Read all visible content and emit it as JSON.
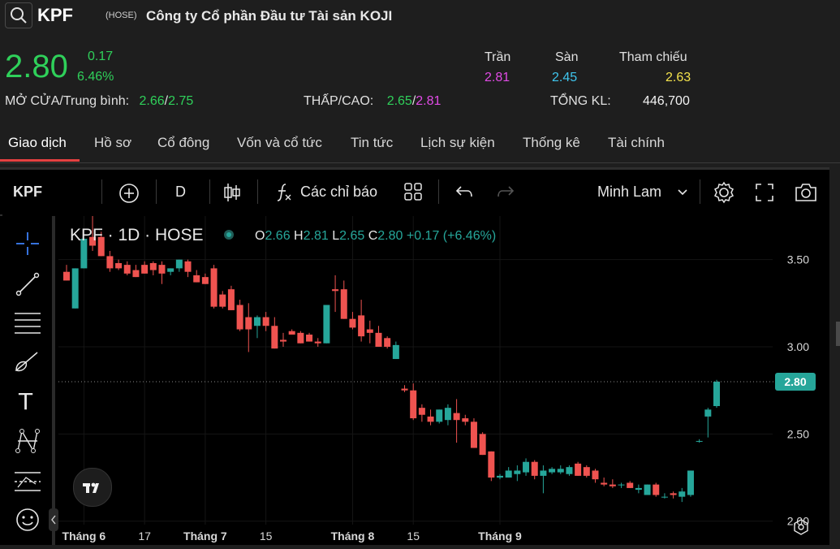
{
  "header": {
    "ticker": "KPF",
    "exchange": "(HOSE)",
    "company": "Công ty Cổ phần Đầu tư Tài sản KOJI",
    "price": "2.80",
    "change": "0.17",
    "change_pct": "6.46%",
    "open_avg_label": "MỞ CỬA/Trung bình:",
    "open": "2.66",
    "avg": "2.75",
    "lowhigh_label": "THẤP/CAO:",
    "low": "2.65",
    "high": "2.81",
    "ceiling_label": "Trần",
    "ceiling": "2.81",
    "floor_label": "Sàn",
    "floor": "2.45",
    "ref_label": "Tham chiếu",
    "ref": "2.63",
    "volume_label": "TỔNG KL:",
    "volume": "446,700",
    "slash": "/"
  },
  "tabs": [
    "Giao dịch",
    "Hồ sơ",
    "Cổ đông",
    "Vốn và cổ tức",
    "Tin tức",
    "Lịch sự kiện",
    "Thống kê",
    "Tài chính"
  ],
  "toolbar": {
    "symbol": "KPF",
    "interval": "D",
    "indicators": "Các chỉ báo",
    "theme": "Minh Lam"
  },
  "legend": {
    "title": "KPF · 1D · HOSE",
    "o_label": "O",
    "o": "2.66",
    "h_label": "H",
    "h": "2.81",
    "l_label": "L",
    "l": "2.65",
    "c_label": "C",
    "c": "2.80",
    "change": "+0.17 (+6.46%)"
  },
  "colors": {
    "up": "#26a69a",
    "down": "#ef5350",
    "accent": "#e44141"
  },
  "chart_data": {
    "type": "candlestick",
    "y_ticks": [
      "3.50",
      "3.00",
      "2.50",
      "2.00"
    ],
    "ylim": [
      1.98,
      3.75
    ],
    "x_labels": [
      {
        "label": "Tháng 6",
        "index": 2
      },
      {
        "label": "17",
        "index": 9
      },
      {
        "label": "Tháng 7",
        "index": 16
      },
      {
        "label": "15",
        "index": 23
      },
      {
        "label": "Tháng 8",
        "index": 33
      },
      {
        "label": "15",
        "index": 40
      },
      {
        "label": "Tháng 9",
        "index": 50
      }
    ],
    "last_price_label": "2.80",
    "last_price": 2.8,
    "candles": [
      {
        "o": 3.43,
        "h": 3.47,
        "l": 3.38,
        "c": 3.38
      },
      {
        "o": 3.22,
        "h": 3.45,
        "l": 3.22,
        "c": 3.45
      },
      {
        "o": 3.45,
        "h": 3.62,
        "l": 3.45,
        "c": 3.62
      },
      {
        "o": 3.63,
        "h": 3.75,
        "l": 3.55,
        "c": 3.58
      },
      {
        "o": 3.63,
        "h": 3.66,
        "l": 3.52,
        "c": 3.52
      },
      {
        "o": 3.52,
        "h": 3.55,
        "l": 3.43,
        "c": 3.45
      },
      {
        "o": 3.48,
        "h": 3.5,
        "l": 3.44,
        "c": 3.45
      },
      {
        "o": 3.47,
        "h": 3.49,
        "l": 3.41,
        "c": 3.42
      },
      {
        "o": 3.44,
        "h": 3.47,
        "l": 3.4,
        "c": 3.4
      },
      {
        "o": 3.47,
        "h": 3.49,
        "l": 3.42,
        "c": 3.42
      },
      {
        "o": 3.48,
        "h": 3.49,
        "l": 3.41,
        "c": 3.44
      },
      {
        "o": 3.47,
        "h": 3.49,
        "l": 3.36,
        "c": 3.42
      },
      {
        "o": 3.43,
        "h": 3.45,
        "l": 3.41,
        "c": 3.45
      },
      {
        "o": 3.45,
        "h": 3.5,
        "l": 3.43,
        "c": 3.5
      },
      {
        "o": 3.49,
        "h": 3.5,
        "l": 3.4,
        "c": 3.43
      },
      {
        "o": 3.41,
        "h": 3.44,
        "l": 3.37,
        "c": 3.37
      },
      {
        "o": 3.4,
        "h": 3.42,
        "l": 3.36,
        "c": 3.36
      },
      {
        "o": 3.45,
        "h": 3.47,
        "l": 3.22,
        "c": 3.23
      },
      {
        "o": 3.3,
        "h": 3.32,
        "l": 3.22,
        "c": 3.23
      },
      {
        "o": 3.33,
        "h": 3.35,
        "l": 3.21,
        "c": 3.21
      },
      {
        "o": 3.24,
        "h": 3.27,
        "l": 3.09,
        "c": 3.1
      },
      {
        "o": 3.17,
        "h": 3.25,
        "l": 2.97,
        "c": 3.1
      },
      {
        "o": 3.12,
        "h": 3.18,
        "l": 3.05,
        "c": 3.17
      },
      {
        "o": 3.17,
        "h": 3.2,
        "l": 3.09,
        "c": 3.12
      },
      {
        "o": 3.12,
        "h": 3.17,
        "l": 2.99,
        "c": 2.99
      },
      {
        "o": 3.04,
        "h": 3.08,
        "l": 3.0,
        "c": 3.03
      },
      {
        "o": 3.09,
        "h": 3.1,
        "l": 3.07,
        "c": 3.07
      },
      {
        "o": 3.08,
        "h": 3.09,
        "l": 3.02,
        "c": 3.02
      },
      {
        "o": 3.07,
        "h": 3.08,
        "l": 3.03,
        "c": 3.03
      },
      {
        "o": 3.03,
        "h": 3.05,
        "l": 3.0,
        "c": 3.02
      },
      {
        "o": 3.02,
        "h": 3.24,
        "l": 3.02,
        "c": 3.24
      },
      {
        "o": 3.33,
        "h": 3.41,
        "l": 3.2,
        "c": 3.32
      },
      {
        "o": 3.33,
        "h": 3.38,
        "l": 3.16,
        "c": 3.16
      },
      {
        "o": 3.16,
        "h": 3.2,
        "l": 3.1,
        "c": 3.11
      },
      {
        "o": 3.18,
        "h": 3.27,
        "l": 3.03,
        "c": 3.06
      },
      {
        "o": 3.1,
        "h": 3.15,
        "l": 3.02,
        "c": 3.08
      },
      {
        "o": 3.08,
        "h": 3.12,
        "l": 3.0,
        "c": 3.0
      },
      {
        "o": 3.05,
        "h": 3.06,
        "l": 2.99,
        "c": 3.0
      },
      {
        "o": 2.93,
        "h": 3.03,
        "l": 2.93,
        "c": 3.01
      },
      {
        "o": 2.76,
        "h": 2.78,
        "l": 2.74,
        "c": 2.75
      },
      {
        "o": 2.75,
        "h": 2.79,
        "l": 2.58,
        "c": 2.59
      },
      {
        "o": 2.65,
        "h": 2.67,
        "l": 2.57,
        "c": 2.61
      },
      {
        "o": 2.6,
        "h": 2.64,
        "l": 2.55,
        "c": 2.57
      },
      {
        "o": 2.57,
        "h": 2.64,
        "l": 2.56,
        "c": 2.64
      },
      {
        "o": 2.58,
        "h": 2.67,
        "l": 2.55,
        "c": 2.65
      },
      {
        "o": 2.62,
        "h": 2.7,
        "l": 2.45,
        "c": 2.58
      },
      {
        "o": 2.59,
        "h": 2.61,
        "l": 2.55,
        "c": 2.57
      },
      {
        "o": 2.57,
        "h": 2.59,
        "l": 2.42,
        "c": 2.42
      },
      {
        "o": 2.5,
        "h": 2.51,
        "l": 2.38,
        "c": 2.38
      },
      {
        "o": 2.4,
        "h": 2.4,
        "l": 2.23,
        "c": 2.25
      },
      {
        "o": 2.25,
        "h": 2.27,
        "l": 2.24,
        "c": 2.26
      },
      {
        "o": 2.25,
        "h": 2.31,
        "l": 2.25,
        "c": 2.29
      },
      {
        "o": 2.27,
        "h": 2.32,
        "l": 2.23,
        "c": 2.29
      },
      {
        "o": 2.28,
        "h": 2.36,
        "l": 2.26,
        "c": 2.34
      },
      {
        "o": 2.34,
        "h": 2.35,
        "l": 2.24,
        "c": 2.26
      },
      {
        "o": 2.26,
        "h": 2.32,
        "l": 2.16,
        "c": 2.29
      },
      {
        "o": 2.28,
        "h": 2.31,
        "l": 2.27,
        "c": 2.3
      },
      {
        "o": 2.28,
        "h": 2.32,
        "l": 2.27,
        "c": 2.3
      },
      {
        "o": 2.27,
        "h": 2.32,
        "l": 2.26,
        "c": 2.31
      },
      {
        "o": 2.33,
        "h": 2.34,
        "l": 2.26,
        "c": 2.26
      },
      {
        "o": 2.31,
        "h": 2.32,
        "l": 2.25,
        "c": 2.26
      },
      {
        "o": 2.29,
        "h": 2.3,
        "l": 2.22,
        "c": 2.24
      },
      {
        "o": 2.22,
        "h": 2.25,
        "l": 2.2,
        "c": 2.21
      },
      {
        "o": 2.21,
        "h": 2.24,
        "l": 2.19,
        "c": 2.2
      },
      {
        "o": 2.21,
        "h": 2.22,
        "l": 2.19,
        "c": 2.21
      },
      {
        "o": 2.22,
        "h": 2.23,
        "l": 2.19,
        "c": 2.19
      },
      {
        "o": 2.18,
        "h": 2.21,
        "l": 2.16,
        "c": 2.19
      },
      {
        "o": 2.15,
        "h": 2.21,
        "l": 2.15,
        "c": 2.21
      },
      {
        "o": 2.21,
        "h": 2.22,
        "l": 2.14,
        "c": 2.15
      },
      {
        "o": 2.14,
        "h": 2.16,
        "l": 2.13,
        "c": 2.14
      },
      {
        "o": 2.16,
        "h": 2.17,
        "l": 2.13,
        "c": 2.15
      },
      {
        "o": 2.14,
        "h": 2.19,
        "l": 2.11,
        "c": 2.17
      },
      {
        "o": 2.15,
        "h": 2.29,
        "l": 2.14,
        "c": 2.29
      },
      {
        "o": 2.46,
        "h": 2.47,
        "l": 2.45,
        "c": 2.46
      },
      {
        "o": 2.6,
        "h": 2.65,
        "l": 2.48,
        "c": 2.64
      },
      {
        "o": 2.66,
        "h": 2.81,
        "l": 2.65,
        "c": 2.8
      }
    ]
  }
}
